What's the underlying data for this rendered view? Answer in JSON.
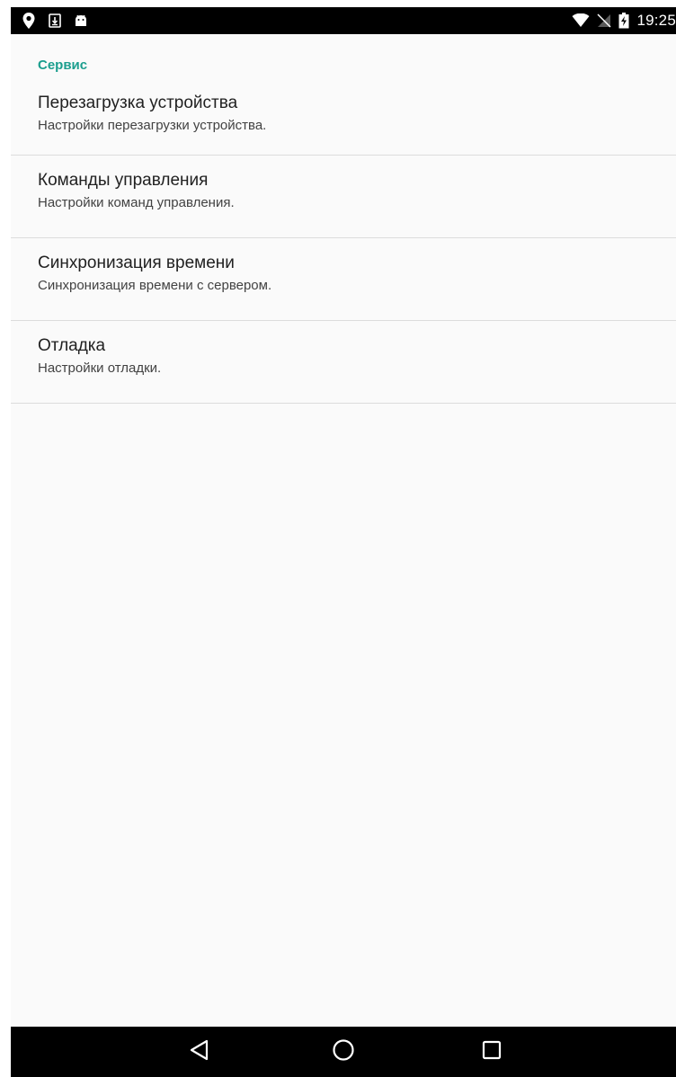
{
  "status_bar": {
    "time": "19:25",
    "left_icons": [
      "location-icon",
      "download-icon",
      "android-icon"
    ],
    "right_icons": [
      "wifi-icon",
      "no-sim-icon",
      "battery-charging-icon"
    ]
  },
  "category": {
    "title": "Сервис",
    "accent_color": "#1b9e8e"
  },
  "preferences": [
    {
      "title": "Перезагрузка устройства",
      "summary": "Настройки перезагрузки устройства."
    },
    {
      "title": "Команды управления",
      "summary": "Настройки команд управления."
    },
    {
      "title": "Синхронизация времени",
      "summary": "Синхронизация времени с сервером."
    },
    {
      "title": "Отладка",
      "summary": "Настройки отладки."
    }
  ],
  "nav_bar": {
    "buttons": [
      "back-icon",
      "home-icon",
      "recents-icon"
    ]
  }
}
